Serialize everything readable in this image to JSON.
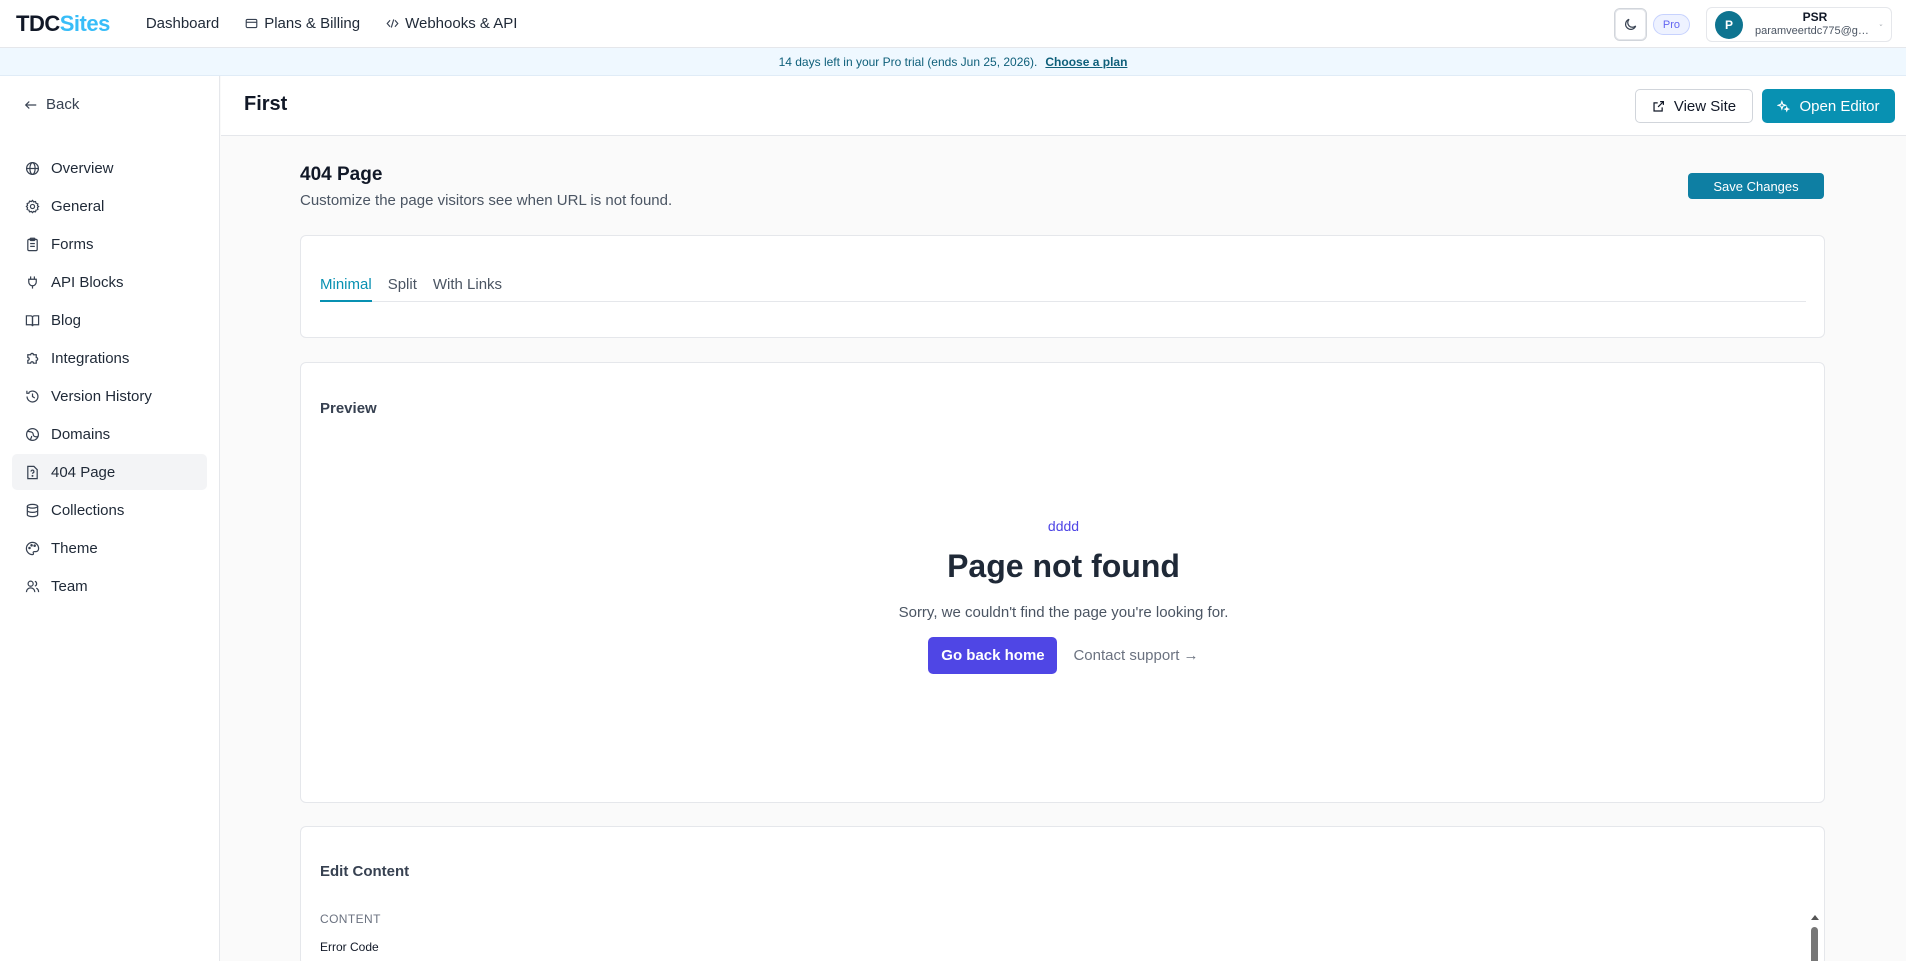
{
  "app": {
    "logo_part1": "TDC",
    "logo_part2": "Sites"
  },
  "topnav": {
    "items": [
      {
        "label": "Dashboard",
        "icon": "none"
      },
      {
        "label": "Plans & Billing",
        "icon": "card-icon"
      },
      {
        "label": "Webhooks & API",
        "icon": "code-icon"
      }
    ]
  },
  "top_right": {
    "theme_icon": "moon-icon",
    "plan_badge": "Pro",
    "user_initial": "P",
    "user_name": "PSR",
    "user_email": "paramveertdc775@gm..."
  },
  "banner": {
    "text": "14 days left in your Pro trial (ends Jun 25, 2026).",
    "link": "Choose a plan"
  },
  "sidebar": {
    "back_label": "Back",
    "items": [
      {
        "label": "Overview",
        "icon": "globe-icon"
      },
      {
        "label": "General",
        "icon": "gear-icon"
      },
      {
        "label": "Forms",
        "icon": "clipboard-icon"
      },
      {
        "label": "API Blocks",
        "icon": "plug-icon"
      },
      {
        "label": "Blog",
        "icon": "book-icon"
      },
      {
        "label": "Integrations",
        "icon": "puzzle-icon"
      },
      {
        "label": "Version History",
        "icon": "history-icon"
      },
      {
        "label": "Domains",
        "icon": "globe-alt-icon"
      },
      {
        "label": "404 Page",
        "icon": "file-question-icon",
        "active": true
      },
      {
        "label": "Collections",
        "icon": "database-icon"
      },
      {
        "label": "Theme",
        "icon": "palette-icon"
      },
      {
        "label": "Team",
        "icon": "users-icon"
      }
    ]
  },
  "page": {
    "title": "First",
    "view_site_label": "View Site",
    "open_editor_label": "Open Editor"
  },
  "section": {
    "title": "404 Page",
    "subtitle": "Customize the page visitors see when URL is not found.",
    "save_label": "Save Changes"
  },
  "tabs": [
    {
      "label": "Minimal",
      "active": true
    },
    {
      "label": "Split",
      "active": false
    },
    {
      "label": "With Links",
      "active": false
    }
  ],
  "preview": {
    "label": "Preview",
    "error_code": "dddd",
    "title": "Page not found",
    "message": "Sorry, we couldn't find the page you're looking for.",
    "primary_label": "Go back home",
    "secondary_label": "Contact support →"
  },
  "edit": {
    "label": "Edit Content",
    "group_label": "CONTENT",
    "field_label": "Error Code"
  },
  "colors": {
    "accent": "#0891b2",
    "preview_accent": "#4f46e5",
    "logo_accent": "#38bdf8"
  }
}
